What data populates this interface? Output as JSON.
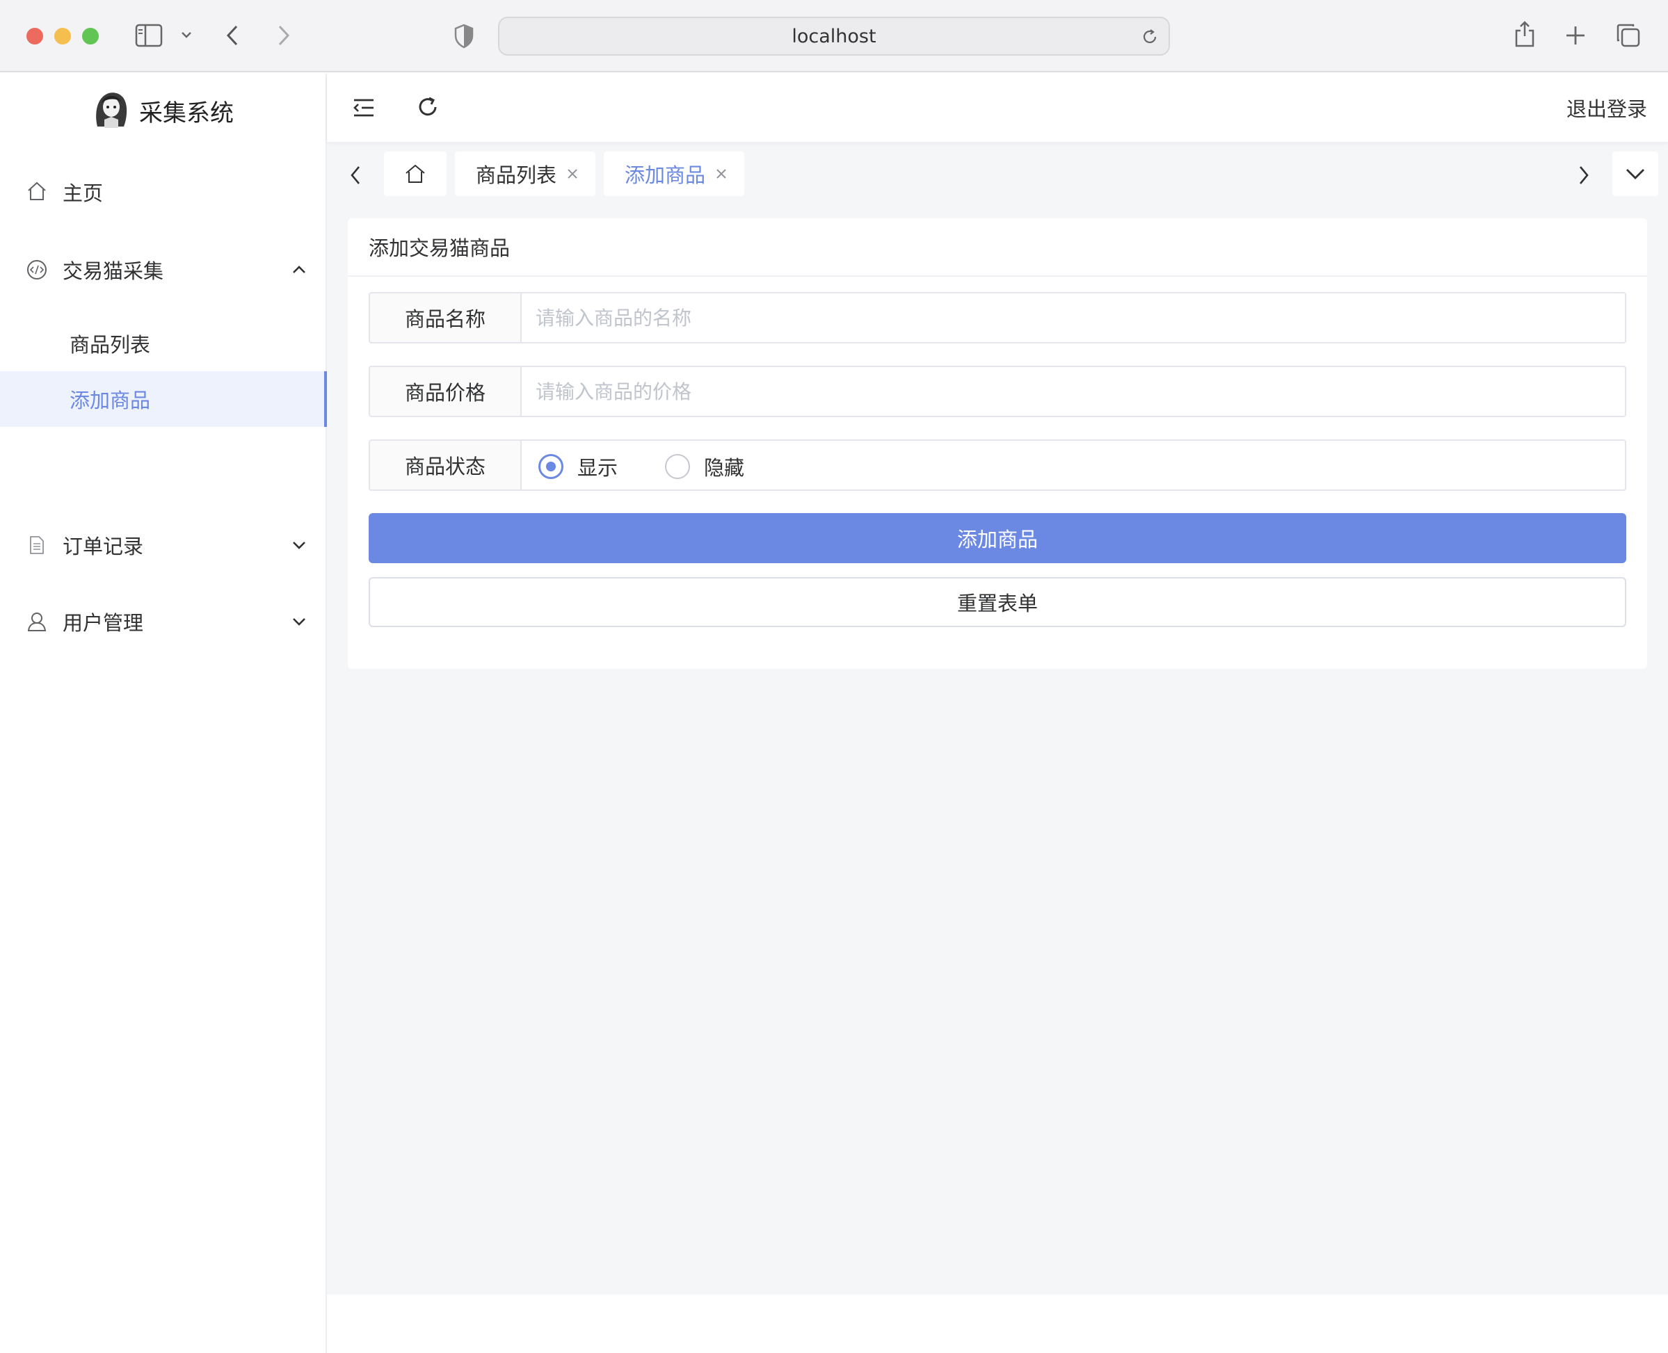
{
  "browser": {
    "url": "localhost",
    "colors": {
      "close": "#ec6a5e",
      "minimize": "#f4bf4f",
      "maximize": "#61c554"
    }
  },
  "sidebar": {
    "logo_text": "采集系统",
    "items": [
      {
        "label": "主页",
        "icon": "home-icon"
      },
      {
        "label": "交易猫采集",
        "icon": "code-icon",
        "expanded": true,
        "children": [
          {
            "label": "商品列表"
          },
          {
            "label": "添加商品",
            "active": true
          }
        ]
      },
      {
        "label": "订单记录",
        "icon": "document-icon",
        "expanded": false
      },
      {
        "label": "用户管理",
        "icon": "user-icon",
        "expanded": false
      }
    ]
  },
  "header": {
    "logout_label": "退出登录"
  },
  "tabs": [
    {
      "label": "商品列表"
    },
    {
      "label": "添加商品",
      "active": true
    }
  ],
  "form": {
    "title": "添加交易猫商品",
    "name_label": "商品名称",
    "name_placeholder": "请输入商品的名称",
    "price_label": "商品价格",
    "price_placeholder": "请输入商品的价格",
    "status_label": "商品状态",
    "status_options": [
      {
        "label": "显示",
        "checked": true
      },
      {
        "label": "隐藏",
        "checked": false
      }
    ],
    "submit_label": "添加商品",
    "reset_label": "重置表单"
  },
  "theme": {
    "accent": "#6b88e3",
    "background": "#f5f6f8"
  }
}
